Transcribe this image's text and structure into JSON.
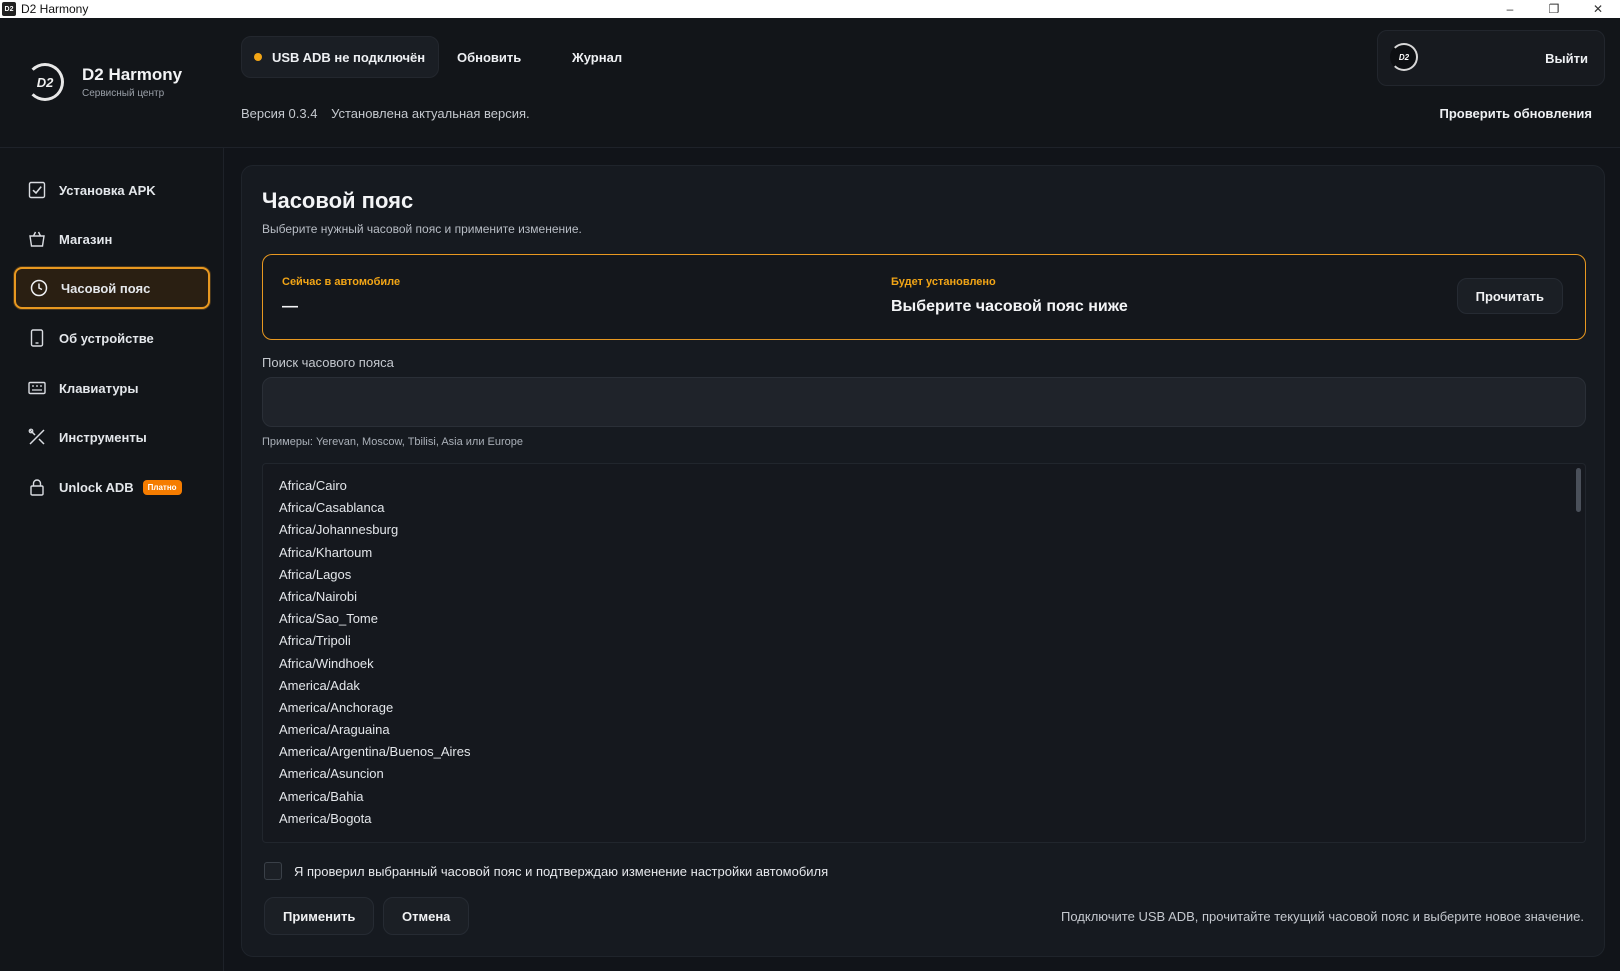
{
  "window": {
    "title": "D2 Harmony",
    "controls": [
      "–",
      "❐",
      "✕"
    ]
  },
  "brand": {
    "logo_text": "D2",
    "title": "D2 Harmony",
    "subtitle": "Сервисный центр"
  },
  "topbar": {
    "status_label": "USB ADB не подключён",
    "status_color": "#f2a516",
    "refresh_label": "Обновить",
    "log_label": "Журнал",
    "version_label": "Версия 0.3.4",
    "version_status": "Установлена актуальная версия.",
    "logout_label": "Выйти",
    "avatar_text": "D2",
    "check_updates_label": "Проверить обновления"
  },
  "sidebar": {
    "items": [
      {
        "label": "Установка APK",
        "icon": "checkbox-icon"
      },
      {
        "label": "Магазин",
        "icon": "basket-icon"
      },
      {
        "label": "Часовой пояс",
        "icon": "clock-icon",
        "active": true
      },
      {
        "label": "Об устройстве",
        "icon": "phone-icon"
      },
      {
        "label": "Клавиатуры",
        "icon": "keyboard-icon"
      },
      {
        "label": "Инструменты",
        "icon": "tools-icon"
      },
      {
        "label": "Unlock ADB",
        "icon": "lock-icon",
        "badge": "Платно"
      }
    ]
  },
  "main": {
    "title": "Часовой пояс",
    "subtitle": "Выберите нужный часовой пояс и примените изменение.",
    "current": {
      "now_label": "Сейчас в автомобиле",
      "now_value": "—",
      "will_label": "Будет установлено",
      "will_value": "Выберите часовой пояс ниже",
      "read_label": "Прочитать"
    },
    "search": {
      "label": "Поиск часового пояса",
      "value": "",
      "hint": "Примеры: Yerevan, Moscow, Tbilisi, Asia или Europe"
    },
    "timezones": [
      "Africa/Cairo",
      "Africa/Casablanca",
      "Africa/Johannesburg",
      "Africa/Khartoum",
      "Africa/Lagos",
      "Africa/Nairobi",
      "Africa/Sao_Tome",
      "Africa/Tripoli",
      "Africa/Windhoek",
      "America/Adak",
      "America/Anchorage",
      "America/Araguaina",
      "America/Argentina/Buenos_Aires",
      "America/Asuncion",
      "America/Bahia",
      "America/Bogota"
    ],
    "confirm_text": "Я проверил выбранный часовой пояс и подтверждаю изменение настройки автомобиля",
    "apply_label": "Применить",
    "cancel_label": "Отмена",
    "footer_hint": "Подключите USB ADB, прочитайте текущий часовой пояс и выберите новое значение."
  },
  "colors": {
    "accent": "#e89820",
    "badge": "#f57c00",
    "background": "#111419"
  }
}
